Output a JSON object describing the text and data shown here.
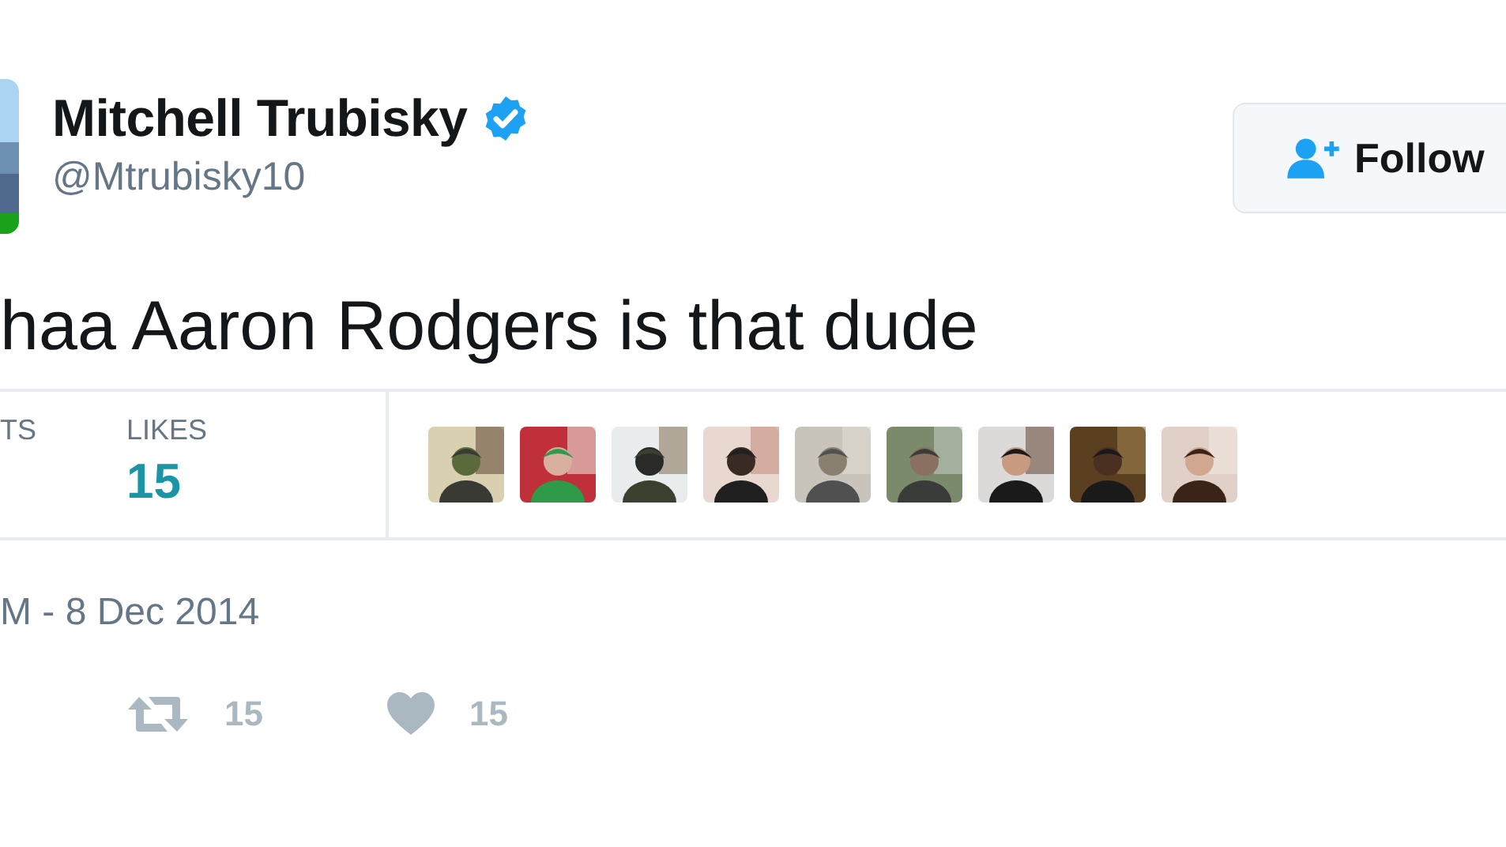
{
  "author": {
    "name": "Mitchell Trubisky",
    "verified": true,
    "handle": "@Mtrubisky10"
  },
  "follow_button": {
    "label": "Follow"
  },
  "tweet_text": "haa Aaron Rodgers is that dude",
  "stats": [
    {
      "label": "TS"
    },
    {
      "label": "LIKES",
      "value": "15"
    }
  ],
  "timestamp": "M - 8 Dec 2014",
  "actions": [
    {
      "kind": "retweet",
      "count": "15"
    },
    {
      "kind": "like",
      "count": "15"
    }
  ]
}
